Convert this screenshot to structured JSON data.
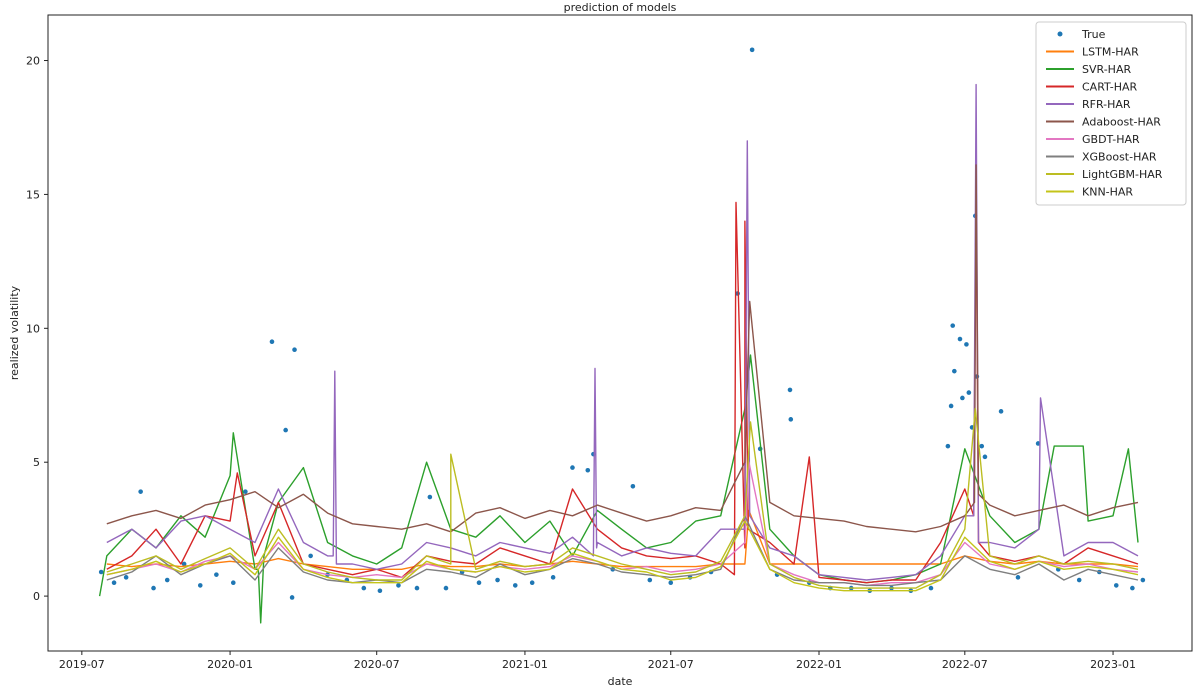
{
  "chart_data": {
    "type": "line",
    "title": "prediction of models",
    "xlabel": "date",
    "ylabel": "realized volatility",
    "xlim": [
      "2019-05-20",
      "2023-04-09"
    ],
    "ylim": [
      -2.05,
      21.7
    ],
    "grid": false,
    "legend_position": "top-right",
    "xticks": [
      "2019-07",
      "2020-01",
      "2020-07",
      "2021-01",
      "2021-07",
      "2022-01",
      "2022-07",
      "2023-01"
    ],
    "yticks": [
      0,
      5,
      10,
      15,
      20
    ],
    "monthly_dates": [
      "2019-08-01",
      "2019-09-01",
      "2019-10-01",
      "2019-11-01",
      "2019-12-01",
      "2020-01-01",
      "2020-02-01",
      "2020-03-01",
      "2020-04-01",
      "2020-05-01",
      "2020-06-01",
      "2020-07-01",
      "2020-08-01",
      "2020-09-01",
      "2020-10-01",
      "2020-11-01",
      "2020-12-01",
      "2021-01-01",
      "2021-02-01",
      "2021-03-01",
      "2021-04-01",
      "2021-05-01",
      "2021-06-01",
      "2021-07-01",
      "2021-08-01",
      "2021-09-01",
      "2021-10-01",
      "2021-11-01",
      "2021-12-01",
      "2022-01-01",
      "2022-02-01",
      "2022-03-01",
      "2022-04-01",
      "2022-05-01",
      "2022-06-01",
      "2022-07-01",
      "2022-08-01",
      "2022-09-01",
      "2022-10-01",
      "2022-11-01",
      "2022-12-01",
      "2023-01-01",
      "2023-02-01"
    ],
    "series": [
      {
        "name": "LSTM-HAR",
        "color": "#ff7f0e",
        "values": [
          1.2,
          1.1,
          1.2,
          1.1,
          1.2,
          1.3,
          1.2,
          1.4,
          1.2,
          1.1,
          1.0,
          1.0,
          1.0,
          1.2,
          1.1,
          1.1,
          1.2,
          1.1,
          1.2,
          1.3,
          1.2,
          1.1,
          1.1,
          1.1,
          1.1,
          1.2,
          1.2,
          1.2,
          1.2,
          1.2,
          1.2,
          1.2,
          1.2,
          1.2,
          1.2,
          1.5,
          1.3,
          1.2,
          1.3,
          1.2,
          1.2,
          1.2,
          1.1
        ],
        "extra": [
          [
            "2021-10-06",
            3.2
          ]
        ]
      },
      {
        "name": "SVR-HAR",
        "color": "#2ca02c",
        "values": [
          1.5,
          2.5,
          1.8,
          3.0,
          2.2,
          4.5,
          1.0,
          3.5,
          4.8,
          2.0,
          1.5,
          1.2,
          1.8,
          5.0,
          2.5,
          2.2,
          3.0,
          2.0,
          2.8,
          1.5,
          3.2,
          2.5,
          1.8,
          2.0,
          2.8,
          3.0,
          7.0,
          2.5,
          1.5,
          0.8,
          0.6,
          0.5,
          0.6,
          0.8,
          1.2,
          5.5,
          3.0,
          2.0,
          2.5,
          5.6,
          2.8,
          3.0,
          2.0
        ],
        "extra": [
          [
            "2019-07-23",
            0.0
          ],
          [
            "2020-01-05",
            6.1
          ],
          [
            "2020-02-05",
            1.0
          ],
          [
            "2020-02-08",
            -1.0
          ],
          [
            "2020-02-12",
            1.5
          ],
          [
            "2021-10-08",
            9.0
          ],
          [
            "2022-10-20",
            5.6
          ],
          [
            "2022-11-25",
            5.6
          ],
          [
            "2023-01-20",
            5.5
          ]
        ]
      },
      {
        "name": "CART-HAR",
        "color": "#d62728",
        "values": [
          1.0,
          1.5,
          2.5,
          1.2,
          3.0,
          2.8,
          1.5,
          3.5,
          1.2,
          1.0,
          0.8,
          1.0,
          0.7,
          1.5,
          1.3,
          1.2,
          1.8,
          1.5,
          1.2,
          4.0,
          2.5,
          1.8,
          1.5,
          1.4,
          1.5,
          1.2,
          1.8,
          2.0,
          1.2,
          0.7,
          0.6,
          0.5,
          0.6,
          0.6,
          2.0,
          4.0,
          1.5,
          1.3,
          1.5,
          1.2,
          1.8,
          1.5,
          1.2
        ],
        "extra": [
          [
            "2020-01-10",
            4.6
          ],
          [
            "2021-09-18",
            0.8
          ],
          [
            "2021-09-20",
            14.7
          ],
          [
            "2021-10-01",
            14.0
          ],
          [
            "2021-10-05",
            2.5
          ],
          [
            "2021-12-20",
            5.2
          ],
          [
            "2022-07-12",
            3.0
          ],
          [
            "2022-07-15",
            15.0
          ],
          [
            "2022-07-18",
            2.0
          ]
        ]
      },
      {
        "name": "RFR-HAR",
        "color": "#9467bd",
        "values": [
          2.0,
          2.5,
          1.8,
          2.8,
          3.0,
          2.5,
          2.0,
          4.0,
          2.0,
          1.5,
          1.2,
          1.0,
          1.2,
          2.0,
          1.8,
          1.5,
          2.0,
          1.8,
          1.6,
          2.2,
          2.0,
          1.5,
          1.8,
          1.6,
          1.5,
          2.5,
          2.5,
          1.8,
          1.5,
          0.8,
          0.7,
          0.6,
          0.7,
          0.8,
          1.5,
          3.0,
          2.0,
          1.8,
          2.5,
          1.5,
          2.0,
          2.0,
          1.5
        ],
        "extra": [
          [
            "2020-05-08",
            1.5
          ],
          [
            "2020-05-10",
            8.4
          ],
          [
            "2020-05-12",
            1.2
          ],
          [
            "2021-03-27",
            1.5
          ],
          [
            "2021-03-29",
            8.5
          ],
          [
            "2021-03-31",
            1.8
          ],
          [
            "2021-10-04",
            17.0
          ],
          [
            "2021-10-07",
            3.0
          ],
          [
            "2022-07-12",
            3.0
          ],
          [
            "2022-07-15",
            19.1
          ],
          [
            "2022-07-18",
            2.0
          ],
          [
            "2022-10-03",
            7.4
          ]
        ]
      },
      {
        "name": "Adaboost-HAR",
        "color": "#8c564b",
        "values": [
          2.7,
          3.0,
          3.2,
          2.9,
          3.4,
          3.6,
          3.9,
          3.3,
          3.8,
          3.1,
          2.7,
          2.6,
          2.5,
          2.7,
          2.4,
          3.1,
          3.3,
          2.9,
          3.2,
          3.0,
          3.4,
          3.1,
          2.8,
          3.0,
          3.3,
          3.2,
          5.0,
          3.5,
          3.0,
          2.9,
          2.8,
          2.6,
          2.5,
          2.4,
          2.6,
          3.0,
          3.4,
          3.0,
          3.2,
          3.4,
          3.0,
          3.3,
          3.5
        ],
        "extra": [
          [
            "2021-10-07",
            11.0
          ],
          [
            "2022-07-13",
            3.5
          ],
          [
            "2022-07-15",
            16.1
          ],
          [
            "2022-07-18",
            3.8
          ]
        ]
      },
      {
        "name": "GBDT-HAR",
        "color": "#e377c2",
        "values": [
          0.8,
          1.0,
          1.2,
          0.9,
          1.3,
          1.5,
          1.0,
          2.0,
          1.0,
          0.8,
          0.7,
          0.8,
          0.7,
          1.2,
          1.0,
          0.9,
          1.1,
          1.0,
          1.1,
          1.5,
          1.3,
          1.0,
          1.1,
          0.9,
          1.0,
          1.2,
          2.0,
          1.2,
          0.8,
          0.5,
          0.5,
          0.4,
          0.5,
          0.5,
          0.8,
          2.0,
          1.2,
          1.0,
          1.3,
          1.1,
          1.2,
          1.0,
          0.9
        ],
        "extra": [
          [
            "2021-10-06",
            5.0
          ]
        ]
      },
      {
        "name": "XGBoost-HAR",
        "color": "#7f7f7f",
        "values": [
          0.6,
          0.9,
          1.5,
          0.8,
          1.2,
          1.5,
          0.6,
          1.8,
          0.9,
          0.6,
          0.5,
          0.6,
          0.5,
          1.0,
          0.9,
          0.7,
          1.2,
          0.8,
          1.0,
          1.4,
          1.2,
          0.9,
          0.8,
          0.7,
          0.8,
          1.0,
          3.0,
          1.0,
          0.6,
          0.5,
          0.5,
          0.4,
          0.4,
          0.5,
          0.6,
          1.5,
          1.0,
          0.8,
          1.2,
          0.6,
          1.0,
          0.8,
          0.6
        ],
        "extra": []
      },
      {
        "name": "LightGBM-HAR",
        "color": "#bcbd22",
        "values": [
          0.9,
          1.2,
          1.5,
          1.0,
          1.4,
          1.8,
          1.0,
          2.5,
          1.2,
          0.9,
          0.7,
          0.6,
          0.6,
          1.5,
          1.2,
          1.0,
          1.3,
          1.1,
          1.2,
          1.8,
          1.5,
          1.2,
          1.0,
          0.8,
          0.9,
          1.3,
          3.0,
          1.2,
          0.7,
          0.4,
          0.3,
          0.3,
          0.3,
          0.3,
          0.8,
          2.5,
          1.5,
          1.2,
          1.5,
          1.2,
          1.3,
          1.2,
          1.0
        ],
        "extra": [
          [
            "2020-10-01",
            5.3
          ],
          [
            "2021-10-08",
            6.5
          ],
          [
            "2022-07-14",
            7.0
          ]
        ]
      },
      {
        "name": "KNN-HAR",
        "color": "#c4c41a",
        "values": [
          0.8,
          1.0,
          1.3,
          0.9,
          1.2,
          1.6,
          0.8,
          2.2,
          1.0,
          0.7,
          0.5,
          0.5,
          0.5,
          1.3,
          1.0,
          0.9,
          1.1,
          0.9,
          1.0,
          1.6,
          1.3,
          1.0,
          0.9,
          0.6,
          0.7,
          1.1,
          2.8,
          1.0,
          0.5,
          0.3,
          0.2,
          0.2,
          0.2,
          0.2,
          0.6,
          2.2,
          1.3,
          1.0,
          1.3,
          1.0,
          1.1,
          1.0,
          0.8
        ],
        "extra": []
      }
    ],
    "true_series": {
      "name": "True",
      "color": "#1f77b4",
      "points": [
        [
          "2019-07-25",
          0.9
        ],
        [
          "2019-08-10",
          0.5
        ],
        [
          "2019-08-25",
          0.7
        ],
        [
          "2019-09-12",
          3.9
        ],
        [
          "2019-09-28",
          0.3
        ],
        [
          "2019-10-15",
          0.6
        ],
        [
          "2019-11-05",
          1.2
        ],
        [
          "2019-11-25",
          0.4
        ],
        [
          "2019-12-15",
          0.8
        ],
        [
          "2020-01-05",
          0.5
        ],
        [
          "2020-01-20",
          3.9
        ],
        [
          "2020-02-22",
          9.5
        ],
        [
          "2020-03-10",
          6.2
        ],
        [
          "2020-03-18",
          -0.05
        ],
        [
          "2020-03-21",
          9.2
        ],
        [
          "2020-04-10",
          1.5
        ],
        [
          "2020-05-01",
          0.8
        ],
        [
          "2020-05-25",
          0.6
        ],
        [
          "2020-06-15",
          0.3
        ],
        [
          "2020-07-05",
          0.2
        ],
        [
          "2020-07-28",
          0.4
        ],
        [
          "2020-08-20",
          0.3
        ],
        [
          "2020-09-05",
          3.7
        ],
        [
          "2020-09-25",
          0.3
        ],
        [
          "2020-10-15",
          0.9
        ],
        [
          "2020-11-05",
          0.5
        ],
        [
          "2020-11-28",
          0.6
        ],
        [
          "2020-12-20",
          0.4
        ],
        [
          "2021-01-10",
          0.5
        ],
        [
          "2021-02-05",
          0.7
        ],
        [
          "2021-03-01",
          4.8
        ],
        [
          "2021-03-20",
          4.7
        ],
        [
          "2021-03-27",
          5.3
        ],
        [
          "2021-04-20",
          1.0
        ],
        [
          "2021-05-15",
          4.1
        ],
        [
          "2021-06-05",
          0.6
        ],
        [
          "2021-07-01",
          0.5
        ],
        [
          "2021-07-25",
          0.7
        ],
        [
          "2021-08-20",
          0.9
        ],
        [
          "2021-09-22",
          11.3
        ],
        [
          "2021-10-10",
          20.4
        ],
        [
          "2021-10-20",
          5.5
        ],
        [
          "2021-11-10",
          0.8
        ],
        [
          "2021-11-26",
          7.7
        ],
        [
          "2021-11-27",
          6.6
        ],
        [
          "2021-12-20",
          0.5
        ],
        [
          "2022-01-15",
          0.3
        ],
        [
          "2022-02-10",
          0.3
        ],
        [
          "2022-03-05",
          0.2
        ],
        [
          "2022-04-01",
          0.3
        ],
        [
          "2022-04-25",
          0.2
        ],
        [
          "2022-05-20",
          0.3
        ],
        [
          "2022-06-10",
          5.6
        ],
        [
          "2022-06-14",
          7.1
        ],
        [
          "2022-06-16",
          10.1
        ],
        [
          "2022-06-18",
          8.4
        ],
        [
          "2022-06-25",
          9.6
        ],
        [
          "2022-06-28",
          7.4
        ],
        [
          "2022-07-03",
          9.4
        ],
        [
          "2022-07-06",
          7.6
        ],
        [
          "2022-07-10",
          6.3
        ],
        [
          "2022-07-14",
          14.2
        ],
        [
          "2022-07-16",
          8.2
        ],
        [
          "2022-07-22",
          5.6
        ],
        [
          "2022-07-26",
          5.2
        ],
        [
          "2022-08-15",
          6.9
        ],
        [
          "2022-09-05",
          0.7
        ],
        [
          "2022-09-30",
          5.7
        ],
        [
          "2022-10-25",
          1.0
        ],
        [
          "2022-11-20",
          0.6
        ],
        [
          "2022-12-15",
          0.9
        ],
        [
          "2023-01-05",
          0.4
        ],
        [
          "2023-01-25",
          0.3
        ],
        [
          "2023-02-07",
          0.6
        ]
      ]
    }
  }
}
